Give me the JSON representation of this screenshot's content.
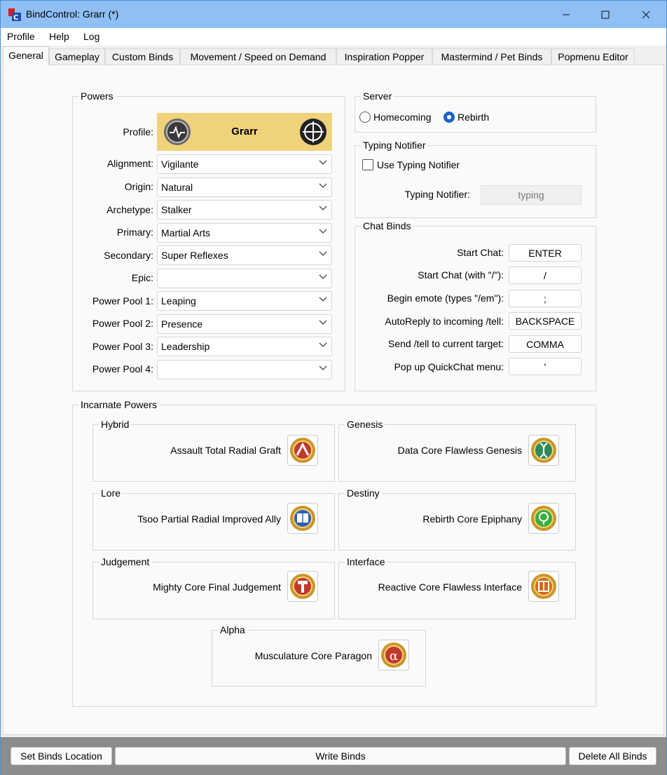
{
  "window": {
    "title": "BindControl: Grarr (*)",
    "minimize": "—",
    "maximize": "☐",
    "close": "✕"
  },
  "menu": [
    "Profile",
    "Help",
    "Log"
  ],
  "tabs": [
    "General",
    "Gameplay",
    "Custom Binds",
    "Movement / Speed on Demand",
    "Inspiration Popper",
    "Mastermind / Pet Binds",
    "Popmenu Editor"
  ],
  "powers": {
    "title": "Powers",
    "profile_label": "Profile:",
    "profile_name": "Grarr",
    "fields": [
      {
        "label": "Alignment:",
        "value": "Vigilante"
      },
      {
        "label": "Origin:",
        "value": "Natural"
      },
      {
        "label": "Archetype:",
        "value": "Stalker"
      },
      {
        "label": "Primary:",
        "value": "Martial Arts"
      },
      {
        "label": "Secondary:",
        "value": "Super Reflexes"
      },
      {
        "label": "Epic:",
        "value": ""
      },
      {
        "label": "Power Pool 1:",
        "value": "Leaping"
      },
      {
        "label": "Power Pool 2:",
        "value": "Presence"
      },
      {
        "label": "Power Pool 3:",
        "value": "Leadership"
      },
      {
        "label": "Power Pool 4:",
        "value": ""
      }
    ]
  },
  "server": {
    "title": "Server",
    "options": [
      "Homecoming",
      "Rebirth"
    ],
    "selected": "Rebirth"
  },
  "typing_notifier": {
    "title": "Typing Notifier",
    "checkbox_label": "Use Typing Notifier",
    "checked": false,
    "field_label": "Typing Notifier:",
    "field_value": "typing"
  },
  "chat_binds": {
    "title": "Chat Binds",
    "rows": [
      {
        "label": "Start Chat:",
        "value": "ENTER"
      },
      {
        "label": "Start Chat (with \"/\"):",
        "value": "/"
      },
      {
        "label": "Begin emote (types \"/em\"):",
        "value": ";"
      },
      {
        "label": "AutoReply to incoming /tell:",
        "value": "BACKSPACE"
      },
      {
        "label": "Send /tell to current target:",
        "value": "COMMA"
      },
      {
        "label": "Pop up QuickChat menu:",
        "value": "'"
      }
    ]
  },
  "incarnate": {
    "title": "Incarnate Powers",
    "slots": [
      {
        "slot": "Hybrid",
        "power": "Assault Total Radial Graft",
        "icon": "hybrid-icon",
        "color": "#c0392b"
      },
      {
        "slot": "Genesis",
        "power": "Data Core Flawless Genesis",
        "icon": "genesis-icon",
        "color": "#2e8b57"
      },
      {
        "slot": "Lore",
        "power": "Tsoo Partial Radial Improved Ally",
        "icon": "lore-icon",
        "color": "#2f5fb3"
      },
      {
        "slot": "Destiny",
        "power": "Rebirth Core Epiphany",
        "icon": "destiny-icon",
        "color": "#3cae3c"
      },
      {
        "slot": "Judgement",
        "power": "Mighty Core Final Judgement",
        "icon": "judgement-icon",
        "color": "#c0392b"
      },
      {
        "slot": "Interface",
        "power": "Reactive Core Flawless Interface",
        "icon": "interface-icon",
        "color": "#d2691e"
      },
      {
        "slot": "Alpha",
        "power": "Musculature Core Paragon",
        "icon": "alpha-icon",
        "color": "#c0392b"
      }
    ]
  },
  "footer": {
    "set_location": "Set Binds Location",
    "write": "Write Binds",
    "delete": "Delete All Binds"
  }
}
